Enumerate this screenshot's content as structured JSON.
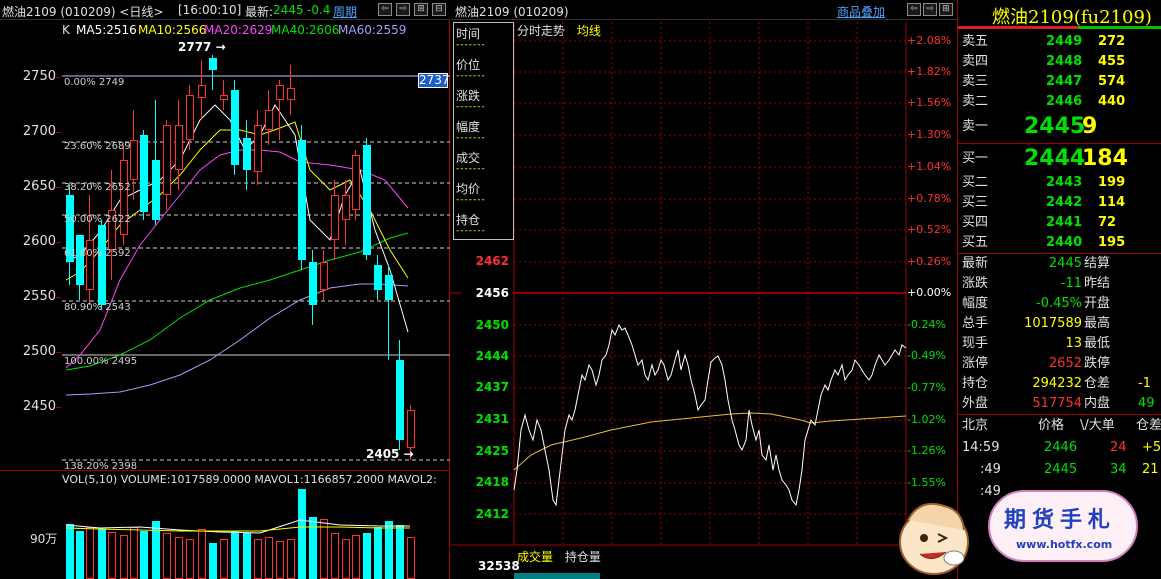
{
  "kline_header": {
    "title": "燃油2109 (010209) <日线>",
    "time": "[16:00:10]",
    "latest_label": "最新:",
    "latest_price": "2445",
    "change": "-0.4",
    "period_label": "周期"
  },
  "ma_legend": {
    "k": "K",
    "ma5": "MA5:2516",
    "ma10": "MA10:2566",
    "ma20": "MA20:2629",
    "ma40": "MA40:2606",
    "ma60": "MA60:2559"
  },
  "kline_axis": [
    "2750",
    "2700",
    "2650",
    "2600",
    "2550",
    "2500",
    "2450"
  ],
  "fib_levels": [
    {
      "label": "0.00%  2749"
    },
    {
      "label": "23.60%  2689"
    },
    {
      "label": "38.20%  2652"
    },
    {
      "label": "50.00%  2622"
    },
    {
      "label": "61.80%  2592"
    },
    {
      "label": "80.90%  2543"
    },
    {
      "label": "100.00%  2495"
    },
    {
      "label": "138.20%  2398"
    }
  ],
  "high_marker": "2777",
  "low_marker": "2405",
  "current_price_tag": "2737",
  "volume_header": "VOL(5,10)  VOLUME:1017589.0000  MAVOL1:1166857.2000  MAVOL2:",
  "volume_axis": "90万",
  "intraday_header": {
    "title": "燃油2109 (010209)",
    "overlay_link": "商品叠加"
  },
  "intraday_subtitle": {
    "tab1": "分时走势",
    "tab2": "均线"
  },
  "info_box": {
    "items": [
      {
        "label": "时间",
        "value": "-------"
      },
      {
        "label": "价位",
        "value": "-------"
      },
      {
        "label": "涨跌",
        "value": "-------"
      },
      {
        "label": "幅度",
        "value": "-------"
      },
      {
        "label": "成交",
        "value": "-------"
      },
      {
        "label": "均价",
        "value": "-------"
      },
      {
        "label": "持仓",
        "value": "-------"
      }
    ]
  },
  "intraday_left_axis": [
    "2462",
    "2456",
    "2450",
    "2444",
    "2437",
    "2431",
    "2425",
    "2418",
    "2412"
  ],
  "intraday_right_axis": [
    "+2.08%",
    "+1.82%",
    "+1.56%",
    "+1.30%",
    "+1.04%",
    "+0.78%",
    "+0.52%",
    "+0.26%",
    "+0.00%",
    "-0.24%",
    "-0.49%",
    "-0.77%",
    "-1.02%",
    "-1.26%",
    "-1.55%"
  ],
  "intraday_volume": {
    "label1": "成交量",
    "label2": "持仓量",
    "axis": "32538"
  },
  "quote": {
    "title": "燃油2109(fu2109)",
    "sell": [
      {
        "label": "卖五",
        "price": "2449",
        "vol": "272"
      },
      {
        "label": "卖四",
        "price": "2448",
        "vol": "455"
      },
      {
        "label": "卖三",
        "price": "2447",
        "vol": "574"
      },
      {
        "label": "卖二",
        "price": "2446",
        "vol": "440"
      }
    ],
    "sell1": {
      "label": "卖一",
      "price": "2445",
      "vol": "9"
    },
    "buy1": {
      "label": "买一",
      "price": "2444",
      "vol": "184"
    },
    "buy": [
      {
        "label": "买二",
        "price": "2443",
        "vol": "199"
      },
      {
        "label": "买三",
        "price": "2442",
        "vol": "114"
      },
      {
        "label": "买四",
        "price": "2441",
        "vol": "72"
      },
      {
        "label": "买五",
        "price": "2440",
        "vol": "195"
      }
    ],
    "stats": [
      {
        "l1": "最新",
        "v1": "2445",
        "l2": "结算",
        "v2": ""
      },
      {
        "l1": "涨跌",
        "v1": "-11",
        "l2": "昨结",
        "v2": ""
      },
      {
        "l1": "幅度",
        "v1": "-0.45%",
        "l2": "开盘",
        "v2": ""
      },
      {
        "l1": "总手",
        "v1": "1017589",
        "l2": "最高",
        "v2": ""
      },
      {
        "l1": "现手",
        "v1": "13",
        "l2": "最低",
        "v2": ""
      },
      {
        "l1": "涨停",
        "v1": "2652",
        "l2": "跌停",
        "v2": ""
      },
      {
        "l1": "持仓",
        "v1": "294232",
        "l2": "仓差",
        "v2": "-1"
      },
      {
        "l1": "外盘",
        "v1": "517754",
        "l2": "内盘",
        "v2": "49"
      }
    ],
    "ticks_header": {
      "loc": "北京",
      "price": "价格",
      "vol": "\\/大单",
      "oi": "仓差"
    },
    "ticks": [
      {
        "time": "14:59",
        "price": "2446",
        "vol": "24",
        "oi": "+5"
      },
      {
        "time": ":49",
        "price": "2445",
        "vol": "34",
        "oi": "21"
      },
      {
        "time": ":49",
        "price": "",
        "vol": "",
        "oi": ""
      }
    ]
  },
  "watermark": {
    "title": "期货手札",
    "url": "www.hotfx.com"
  },
  "colors": {
    "up": "#ff3030",
    "down": "#00ffff",
    "green": "#00e000",
    "yellow": "#ffff00",
    "grid_red": "#a00000"
  }
}
